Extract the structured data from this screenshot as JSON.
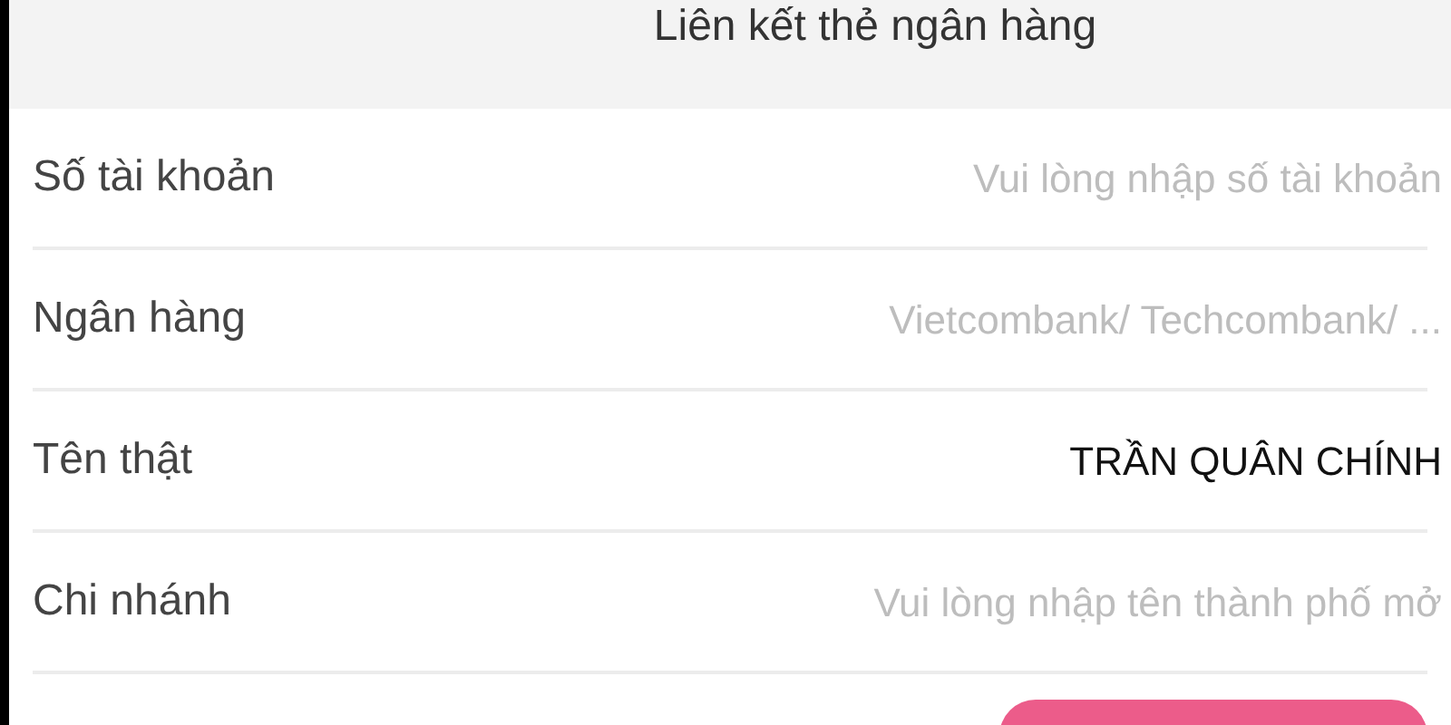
{
  "header": {
    "title": "Liên kết thẻ ngân hàng"
  },
  "fields": [
    {
      "label": "Số tài khoản",
      "placeholder": "Vui lòng nhập số tài khoản"
    },
    {
      "label": "Ngân hàng",
      "placeholder": "Vietcombank/ Techcombank/ ..."
    },
    {
      "label": "Tên thật",
      "value": "TRẦN QUÂN CHÍNH"
    },
    {
      "label": "Chi nhánh",
      "placeholder": "Vui lòng nhập tên thành phố mở"
    }
  ]
}
